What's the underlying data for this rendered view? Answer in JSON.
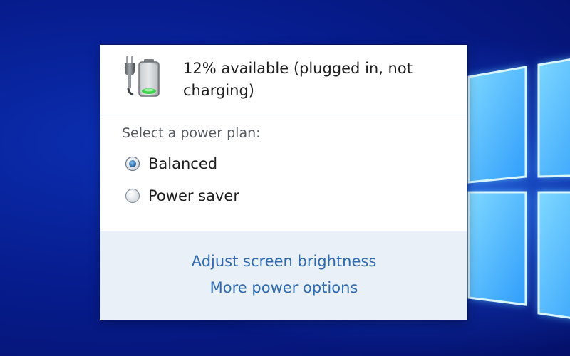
{
  "battery": {
    "icon": "battery-plugged-icon",
    "status": "12% available (plugged in, not charging)"
  },
  "power_plan": {
    "heading": "Select a power plan:",
    "options": [
      {
        "label": "Balanced",
        "selected": true
      },
      {
        "label": "Power saver",
        "selected": false
      }
    ]
  },
  "links": {
    "adjust_brightness": "Adjust screen brightness",
    "more_options": "More power options"
  },
  "colors": {
    "desktop_blue": "#0b2eb0",
    "link_blue": "#2d6ab2",
    "links_panel": "#eaf0f7"
  }
}
